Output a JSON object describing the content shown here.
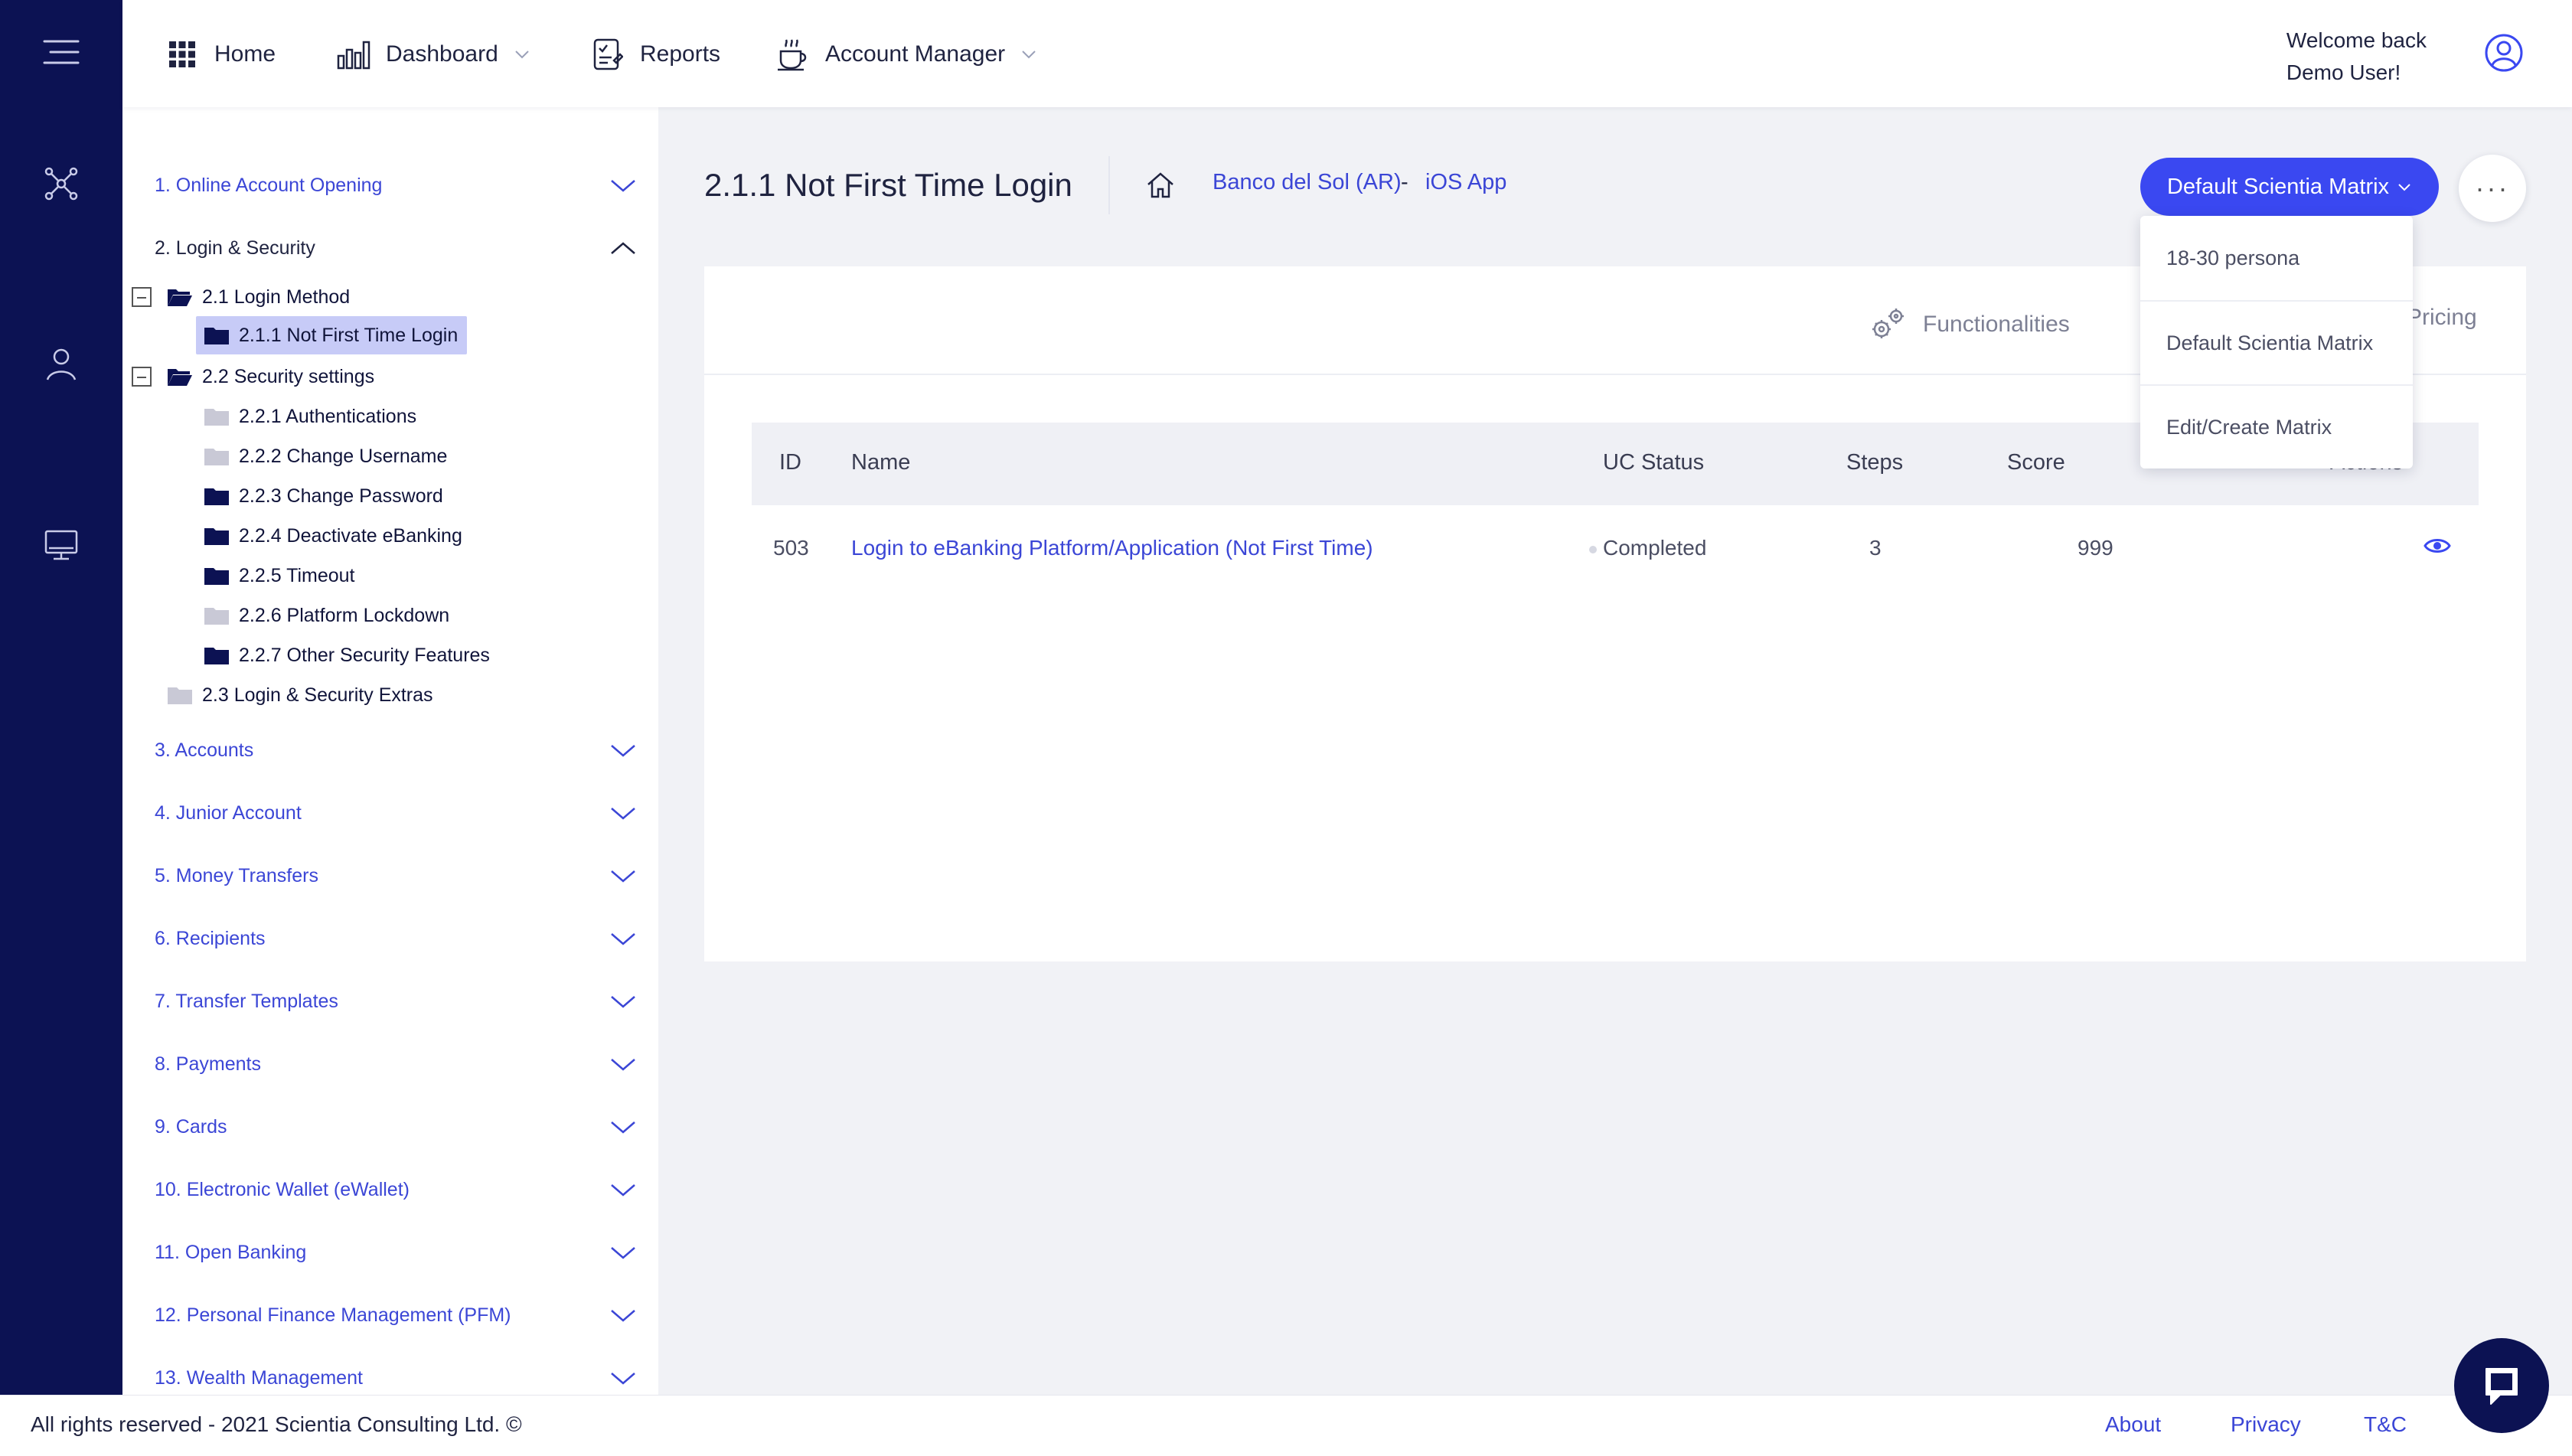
{
  "colors": {
    "rail": "#0c1253",
    "accent": "#3a48f1",
    "link": "#3b46d6",
    "selected_bg": "#c7cbf7"
  },
  "rail": {
    "icons": [
      "hamburger-menu-icon",
      "network-icon",
      "person-icon",
      "monitor-icon"
    ]
  },
  "topnav": {
    "home": "Home",
    "dashboard": "Dashboard",
    "reports": "Reports",
    "account_manager": "Account Manager",
    "welcome_line1": "Welcome back",
    "welcome_line2": "Demo User!"
  },
  "sidebar": {
    "sections": [
      "1. Online Account Opening",
      "2. Login & Security",
      "3. Accounts",
      "4. Junior Account",
      "5. Money Transfers",
      "6. Recipients",
      "7. Transfer Templates",
      "8. Payments",
      "9. Cards",
      "10. Electronic Wallet (eWallet)",
      "11. Open Banking",
      "12. Personal Finance Management (PFM)",
      "13. Wealth Management"
    ],
    "tree": {
      "login_method": "2.1 Login Method",
      "not_first_time": "2.1.1 Not First Time Login",
      "security_settings": "2.2 Security settings",
      "children": [
        "2.2.1 Authentications",
        "2.2.2 Change Username",
        "2.2.3 Change Password",
        "2.2.4 Deactivate eBanking",
        "2.2.5 Timeout",
        "2.2.6 Platform Lockdown",
        "2.2.7 Other Security Features"
      ],
      "extras": "2.3 Login & Security Extras"
    }
  },
  "main": {
    "title": "2.1.1 Not First Time Login",
    "breadcrumb": {
      "bank": "Banco del Sol (AR)",
      "sep": "-",
      "app": "iOS App"
    },
    "matrix_button": "Default Scientia Matrix",
    "more_label": "···",
    "tabs": {
      "functionalities": "Functionalities",
      "pricing": "Pricing"
    },
    "table": {
      "headers": {
        "id": "ID",
        "name": "Name",
        "status": "UC Status",
        "steps": "Steps",
        "score": "Score",
        "actions": "Actions"
      },
      "rows": [
        {
          "id": "503",
          "name": "Login to eBanking Platform/Application (Not First Time)",
          "status": "Completed",
          "steps": "3",
          "score": "999"
        }
      ]
    },
    "dropdown": [
      "18-30 persona",
      "Default Scientia Matrix",
      "Edit/Create Matrix"
    ]
  },
  "footer": {
    "copyright": "All rights reserved - 2021 Scientia Consulting Ltd. ©",
    "about": "About",
    "privacy": "Privacy",
    "tc": "T&C"
  }
}
